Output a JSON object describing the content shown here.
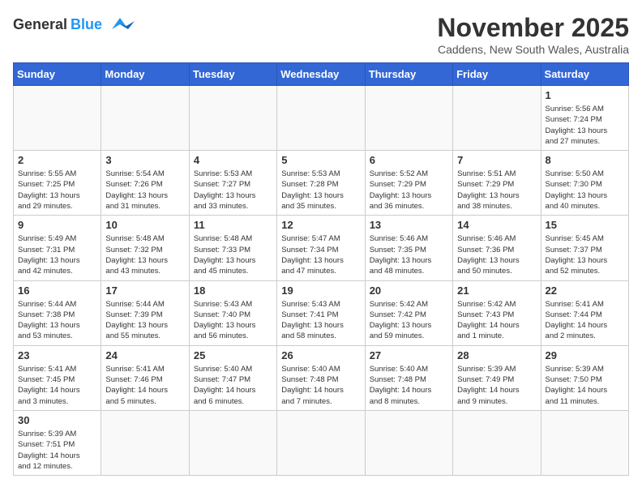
{
  "header": {
    "logo_general": "General",
    "logo_blue": "Blue",
    "main_title": "November 2025",
    "subtitle": "Caddens, New South Wales, Australia"
  },
  "weekdays": [
    "Sunday",
    "Monday",
    "Tuesday",
    "Wednesday",
    "Thursday",
    "Friday",
    "Saturday"
  ],
  "weeks": [
    [
      {
        "day": "",
        "info": ""
      },
      {
        "day": "",
        "info": ""
      },
      {
        "day": "",
        "info": ""
      },
      {
        "day": "",
        "info": ""
      },
      {
        "day": "",
        "info": ""
      },
      {
        "day": "",
        "info": ""
      },
      {
        "day": "1",
        "info": "Sunrise: 5:56 AM\nSunset: 7:24 PM\nDaylight: 13 hours\nand 27 minutes."
      }
    ],
    [
      {
        "day": "2",
        "info": "Sunrise: 5:55 AM\nSunset: 7:25 PM\nDaylight: 13 hours\nand 29 minutes."
      },
      {
        "day": "3",
        "info": "Sunrise: 5:54 AM\nSunset: 7:26 PM\nDaylight: 13 hours\nand 31 minutes."
      },
      {
        "day": "4",
        "info": "Sunrise: 5:53 AM\nSunset: 7:27 PM\nDaylight: 13 hours\nand 33 minutes."
      },
      {
        "day": "5",
        "info": "Sunrise: 5:53 AM\nSunset: 7:28 PM\nDaylight: 13 hours\nand 35 minutes."
      },
      {
        "day": "6",
        "info": "Sunrise: 5:52 AM\nSunset: 7:29 PM\nDaylight: 13 hours\nand 36 minutes."
      },
      {
        "day": "7",
        "info": "Sunrise: 5:51 AM\nSunset: 7:29 PM\nDaylight: 13 hours\nand 38 minutes."
      },
      {
        "day": "8",
        "info": "Sunrise: 5:50 AM\nSunset: 7:30 PM\nDaylight: 13 hours\nand 40 minutes."
      }
    ],
    [
      {
        "day": "9",
        "info": "Sunrise: 5:49 AM\nSunset: 7:31 PM\nDaylight: 13 hours\nand 42 minutes."
      },
      {
        "day": "10",
        "info": "Sunrise: 5:48 AM\nSunset: 7:32 PM\nDaylight: 13 hours\nand 43 minutes."
      },
      {
        "day": "11",
        "info": "Sunrise: 5:48 AM\nSunset: 7:33 PM\nDaylight: 13 hours\nand 45 minutes."
      },
      {
        "day": "12",
        "info": "Sunrise: 5:47 AM\nSunset: 7:34 PM\nDaylight: 13 hours\nand 47 minutes."
      },
      {
        "day": "13",
        "info": "Sunrise: 5:46 AM\nSunset: 7:35 PM\nDaylight: 13 hours\nand 48 minutes."
      },
      {
        "day": "14",
        "info": "Sunrise: 5:46 AM\nSunset: 7:36 PM\nDaylight: 13 hours\nand 50 minutes."
      },
      {
        "day": "15",
        "info": "Sunrise: 5:45 AM\nSunset: 7:37 PM\nDaylight: 13 hours\nand 52 minutes."
      }
    ],
    [
      {
        "day": "16",
        "info": "Sunrise: 5:44 AM\nSunset: 7:38 PM\nDaylight: 13 hours\nand 53 minutes."
      },
      {
        "day": "17",
        "info": "Sunrise: 5:44 AM\nSunset: 7:39 PM\nDaylight: 13 hours\nand 55 minutes."
      },
      {
        "day": "18",
        "info": "Sunrise: 5:43 AM\nSunset: 7:40 PM\nDaylight: 13 hours\nand 56 minutes."
      },
      {
        "day": "19",
        "info": "Sunrise: 5:43 AM\nSunset: 7:41 PM\nDaylight: 13 hours\nand 58 minutes."
      },
      {
        "day": "20",
        "info": "Sunrise: 5:42 AM\nSunset: 7:42 PM\nDaylight: 13 hours\nand 59 minutes."
      },
      {
        "day": "21",
        "info": "Sunrise: 5:42 AM\nSunset: 7:43 PM\nDaylight: 14 hours\nand 1 minute."
      },
      {
        "day": "22",
        "info": "Sunrise: 5:41 AM\nSunset: 7:44 PM\nDaylight: 14 hours\nand 2 minutes."
      }
    ],
    [
      {
        "day": "23",
        "info": "Sunrise: 5:41 AM\nSunset: 7:45 PM\nDaylight: 14 hours\nand 3 minutes."
      },
      {
        "day": "24",
        "info": "Sunrise: 5:41 AM\nSunset: 7:46 PM\nDaylight: 14 hours\nand 5 minutes."
      },
      {
        "day": "25",
        "info": "Sunrise: 5:40 AM\nSunset: 7:47 PM\nDaylight: 14 hours\nand 6 minutes."
      },
      {
        "day": "26",
        "info": "Sunrise: 5:40 AM\nSunset: 7:48 PM\nDaylight: 14 hours\nand 7 minutes."
      },
      {
        "day": "27",
        "info": "Sunrise: 5:40 AM\nSunset: 7:48 PM\nDaylight: 14 hours\nand 8 minutes."
      },
      {
        "day": "28",
        "info": "Sunrise: 5:39 AM\nSunset: 7:49 PM\nDaylight: 14 hours\nand 9 minutes."
      },
      {
        "day": "29",
        "info": "Sunrise: 5:39 AM\nSunset: 7:50 PM\nDaylight: 14 hours\nand 11 minutes."
      }
    ],
    [
      {
        "day": "30",
        "info": "Sunrise: 5:39 AM\nSunset: 7:51 PM\nDaylight: 14 hours\nand 12 minutes."
      },
      {
        "day": "",
        "info": ""
      },
      {
        "day": "",
        "info": ""
      },
      {
        "day": "",
        "info": ""
      },
      {
        "day": "",
        "info": ""
      },
      {
        "day": "",
        "info": ""
      },
      {
        "day": "",
        "info": ""
      }
    ]
  ]
}
